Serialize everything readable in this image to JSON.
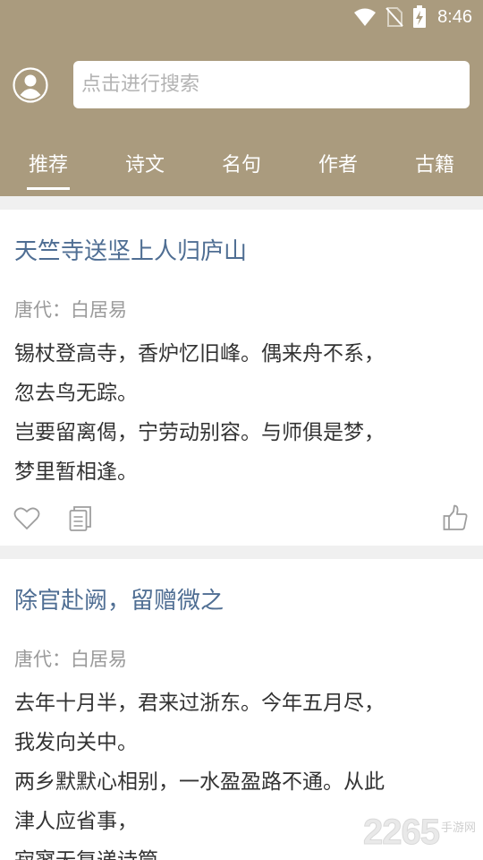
{
  "status": {
    "time": "8:46"
  },
  "search": {
    "placeholder": "点击进行搜索"
  },
  "tabs": [
    {
      "label": "推荐"
    },
    {
      "label": "诗文"
    },
    {
      "label": "名句"
    },
    {
      "label": "作者"
    },
    {
      "label": "古籍"
    }
  ],
  "cards": [
    {
      "title": "天竺寺送坚上人归庐山",
      "meta": "唐代：白居易",
      "lines": [
        "锡杖登高寺，香炉忆旧峰。偶来舟不系，",
        "忽去鸟无踪。",
        "岂要留离偈，宁劳动别容。与师俱是梦，",
        "梦里暂相逢。"
      ]
    },
    {
      "title": "除官赴阙，留赠微之",
      "meta": "唐代：白居易",
      "lines": [
        "去年十月半，君来过浙东。今年五月尽，",
        "我发向关中。",
        "两乡默默心相别，一水盈盈路不通。从此",
        "津人应省事，",
        "寂寥无复递诗筒。"
      ]
    }
  ],
  "watermark": {
    "number": "2265",
    "text": "手游网"
  },
  "colors": {
    "header": "#aa9b7e",
    "title": "#4f6e93",
    "meta": "#9a9a9a"
  }
}
